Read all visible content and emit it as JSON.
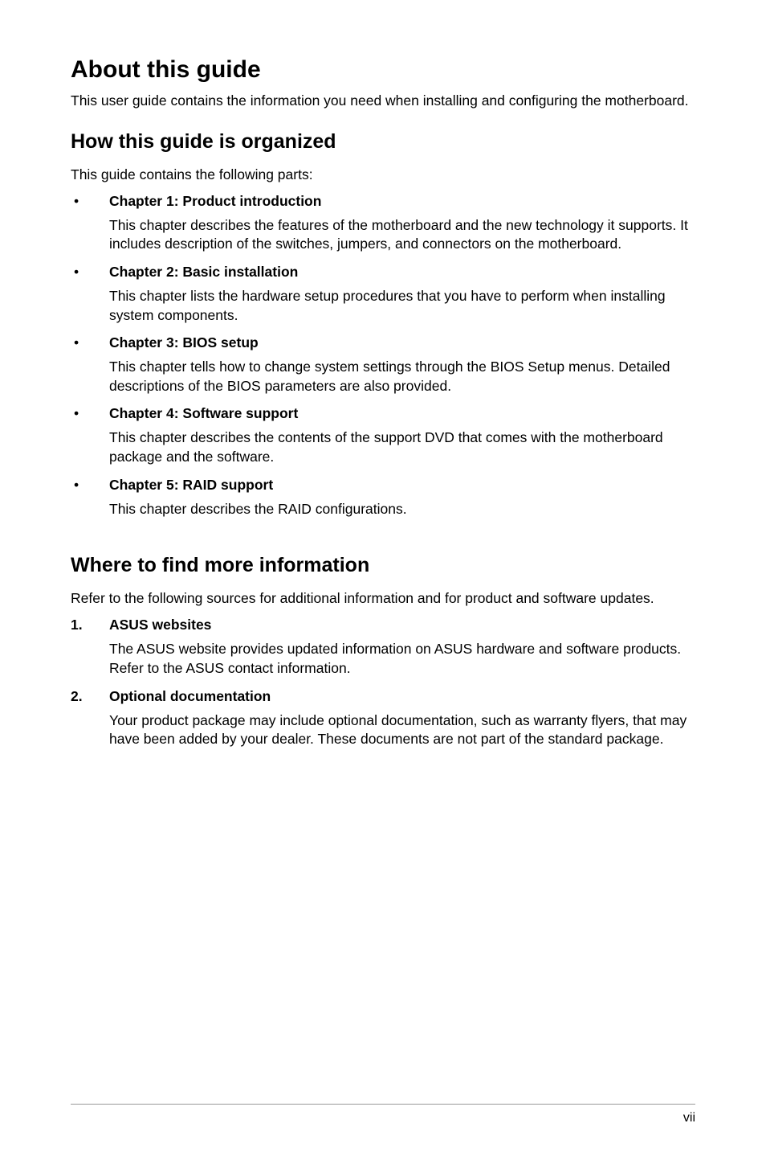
{
  "title": "About this guide",
  "intro": "This user guide contains the information you need when installing and configuring the motherboard.",
  "section1": {
    "heading": "How this guide is organized",
    "intro": "This guide contains the following parts:",
    "items": [
      {
        "title": "Chapter 1: Product introduction",
        "body": "This chapter describes the features of the motherboard and the new technology it supports. It includes description of the switches, jumpers, and connectors on the motherboard."
      },
      {
        "title": "Chapter 2: Basic installation",
        "body": "This chapter lists the hardware setup procedures that you have to perform when installing system components."
      },
      {
        "title": "Chapter 3: BIOS setup",
        "body": "This chapter tells how to change system settings through the BIOS Setup menus. Detailed descriptions of the BIOS parameters are also provided."
      },
      {
        "title": "Chapter 4: Software support",
        "body": "This chapter describes the contents of the support DVD that comes with the motherboard package and the software."
      },
      {
        "title": "Chapter 5: RAID support",
        "body": "This chapter describes the RAID configurations."
      }
    ]
  },
  "section2": {
    "heading": "Where to find more information",
    "intro": "Refer to the following sources for additional information and for product and software updates.",
    "items": [
      {
        "num": "1.",
        "title": "ASUS websites",
        "body": "The ASUS website provides updated information on ASUS hardware and software products. Refer to the ASUS contact information."
      },
      {
        "num": "2.",
        "title": "Optional documentation",
        "body": "Your product package may include optional documentation, such as warranty flyers, that may have been added by your dealer. These documents are not part of the standard package."
      }
    ]
  },
  "footer": "vii"
}
